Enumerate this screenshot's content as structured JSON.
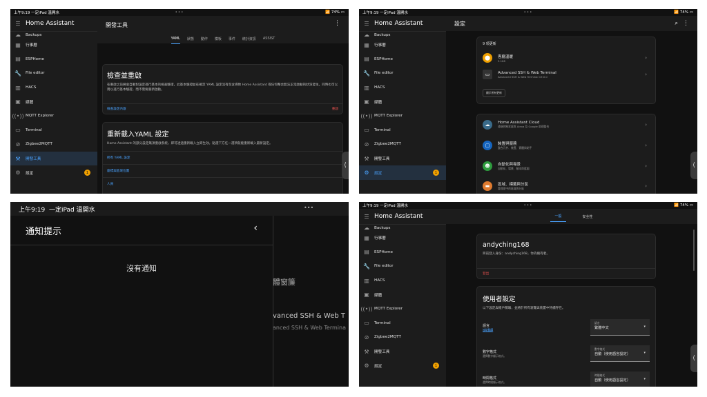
{
  "status": {
    "time_small": "上午9:19",
    "time_label": "一定iPad 溫開水",
    "battery": "74%",
    "dots": "•••"
  },
  "sidebar": {
    "title": "Home Assistant",
    "items": [
      {
        "label": "Backups",
        "icon": "backup-icon"
      },
      {
        "label": "行事曆",
        "icon": "calendar-icon"
      },
      {
        "label": "ESPHome",
        "icon": "chip-icon"
      },
      {
        "label": "File editor",
        "icon": "wrench-icon"
      },
      {
        "label": "HACS",
        "icon": "store-icon"
      },
      {
        "label": "媒體",
        "icon": "media-icon"
      },
      {
        "label": "MQTT Explorer",
        "icon": "antenna-icon"
      },
      {
        "label": "Terminal",
        "icon": "terminal-icon"
      },
      {
        "label": "Zigbee2MQTT",
        "icon": "zigbee-icon"
      },
      {
        "label": "開發工具",
        "icon": "hammer-icon"
      },
      {
        "label": "設定",
        "icon": "gear-icon",
        "badge": "1"
      }
    ]
  },
  "p1": {
    "title": "開發工具",
    "tabs": [
      "YAML",
      "狀態",
      "動作",
      "模板",
      "事件",
      "統計資訊",
      "ASSIST"
    ],
    "card1_title": "檢查並重啟",
    "card1_body": "在重啟之前將會自動對設定進行基本的檢查驗證，此基本驗證並在確定 YAML 設定沒有包含導致 Home Assistant 或任何整合無法正常啟動的狀況發生。同時也可以用以進行基本驗證，而不需要重新啟動。",
    "card1_link": "檢查設定內容",
    "card1_restart": "重啟",
    "card2_title": "重新載入YAML 設定",
    "card2_body": "Home Assistant 的部分設定無須重啟系統，即可透過重新載入立即生效。點選下方任一選項就能重新載入最新設定。",
    "card2_links": [
      "所有 YAML 設定",
      "座標與區域位置",
      "人員"
    ]
  },
  "p2": {
    "title": "設定",
    "updates_title": "9 項更新",
    "updates": [
      {
        "name": "客廳溫暖",
        "sub": "5.168"
      },
      {
        "name": "Advanced SSH & Web Terminal",
        "sub": "Advanced SSH & Web Terminal 19.0.0"
      }
    ],
    "show_all": "顯示所有更新",
    "items": [
      {
        "name": "Home Assistant Cloud",
        "sub": "遠端控制家庭與 Alexa 及 Google 助理整合"
      },
      {
        "name": "裝置與服務",
        "sub": "整合元件、裝置、實體與助手"
      },
      {
        "name": "自動化與場景",
        "sub": "自動化、場景、腳本與藍圖"
      },
      {
        "name": "區域、標籤與分區",
        "sub": "管理家中的區域與分區"
      }
    ]
  },
  "p3": {
    "status_time": "上午9:19",
    "status_label": "一定iPad 溫開水",
    "title": "通知提示",
    "empty": "沒有通知",
    "bg_text1": "體窗簾",
    "bg_text2": "vanced SSH & Web T",
    "bg_text3": "anced SSH & Web Termina"
  },
  "p4": {
    "tabs": [
      "一般",
      "安全性"
    ],
    "user": "andyching168",
    "logged_in": "目前登入身份：andyching168，你為擁有者。",
    "logout": "登出",
    "settings_title": "使用者設定",
    "settings_sub": "以下設定與帳戶關聯，並將於所有瀏覽與裝置中持續存在。",
    "rows": [
      {
        "name": "語言",
        "sub": "協助翻譯",
        "select_label": "語言",
        "select_value": "繁體中文"
      },
      {
        "name": "數字格式",
        "sub": "選擇數字顯示格式。",
        "select_label": "數字格式",
        "select_value": "自動（使用語言設定）"
      },
      {
        "name": "時間格式",
        "sub": "選擇時間顯示格式。",
        "select_label": "時間格式",
        "select_value": "自動（使用語言設定）"
      }
    ]
  }
}
